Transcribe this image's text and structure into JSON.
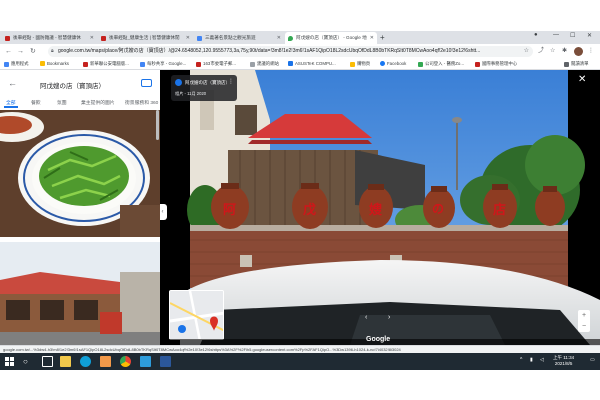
{
  "browser": {
    "tabs": [
      {
        "label": "後車經點 - 國防雜議 - 智慧健康休",
        "color": "#c5221f"
      },
      {
        "label": "後車經點_健康生活 | 智慧健康休閒",
        "color": "#c5221f"
      },
      {
        "label": "三義著名景點之觀光旅遊",
        "color": "#4285f4"
      },
      {
        "label": "阿戊嫂の店（寶頂店） - Google 地",
        "color": "#34a853"
      }
    ],
    "new_tab_glyph": "+",
    "url": "google.com.tw/maps/place/阿戊嫂の店（寶頂店）/@24.6548052,120.9555773,3a,75y,90t/data=!3m8!1e2!3m6!1sAF1QipO18L2sdcUbqOfDdL8B0bTKRqSIt0T8MCwAoo4qf!2e10!3e12!6shtt...",
    "bookmarks": [
      {
        "label": "應用程式",
        "color": "#4285f4"
      },
      {
        "label": "Bookmarks",
        "color": "#fbbc04"
      },
      {
        "label": "新華聯公安電腦版...",
        "color": "#c5221f"
      },
      {
        "label": "每秒共享 - Google...",
        "color": "#4285f4"
      },
      {
        "label": "163市委電子郵...",
        "color": "#c5221f"
      },
      {
        "label": "建議的網站",
        "color": "#9aa0a6"
      },
      {
        "label": "ASUSTeK COMPU...",
        "color": "#1a73e8"
      },
      {
        "label": "購物頁",
        "color": "#fbbc04"
      },
      {
        "label": "Facebook",
        "color": "#1877f2"
      },
      {
        "label": "公司登入 - 醫務Zo...",
        "color": "#34a853"
      },
      {
        "label": "國際事務管理中心",
        "color": "#c5221f"
      },
      {
        "label": "閱讀清單",
        "color": "#5f6368"
      }
    ]
  },
  "panel": {
    "title": "阿戊嫂の店（寶頂店）",
    "tabs": [
      "全部",
      "餐飲",
      "氛圍",
      "業主提供的圖片",
      "街景服務和 360"
    ]
  },
  "viewer": {
    "uploader": "阿戊嫂の店（寶頂店）",
    "date": "相片 - 11月 2020",
    "watermark": "Google",
    "jar_chars": [
      "阿",
      "戊",
      "嫂",
      "の",
      "店"
    ]
  },
  "status_url": "google.com.tw/...%3dw4-h3!m8!1e2!3m6!1sAF1QipO18L2sdcUbqOfDdL8B0bTKRqSIt0T8MCwAoo4qf%2e10!3e12!6shttps%3A%2F%2Flh5.googleusercontent.com%2Fp%2FAF1QipO...%3Dw1396-h1024-k-no!7i4032!8i3024",
  "taskbar": {
    "time": "上午 11:34",
    "date": "2021/8/5",
    "apps": [
      {
        "name": "task-view",
        "color": "#ffffff"
      },
      {
        "name": "file-explorer",
        "color": "#f2c94c"
      },
      {
        "name": "edge",
        "color": "#0f9fd8"
      },
      {
        "name": "chrome",
        "color": "#34a853"
      },
      {
        "name": "app-orange",
        "color": "#f2994a"
      },
      {
        "name": "store",
        "color": "#2d9cdb"
      },
      {
        "name": "word",
        "color": "#2b579a"
      }
    ]
  },
  "colors": {
    "accent": "#1a73e8",
    "jar_text": "#d0161a",
    "roof": "#d63a3a"
  }
}
